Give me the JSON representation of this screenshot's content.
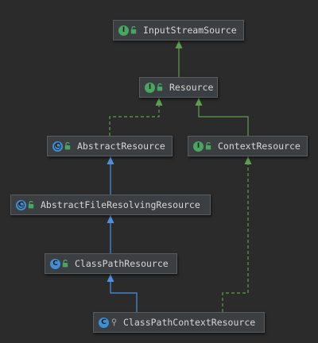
{
  "nodes": [
    {
      "id": "InputStreamSource",
      "label": "InputStreamSource",
      "kind": "interface",
      "badge": "I",
      "access": "public",
      "badge_color": "#4aa561"
    },
    {
      "id": "Resource",
      "label": "Resource",
      "kind": "interface",
      "badge": "I",
      "access": "public",
      "badge_color": "#4aa561"
    },
    {
      "id": "AbstractResource",
      "label": "AbstractResource",
      "kind": "abstract-class",
      "badge": "C",
      "access": "public",
      "badge_color": "#3f8fd6"
    },
    {
      "id": "ContextResource",
      "label": "ContextResource",
      "kind": "interface",
      "badge": "I",
      "access": "public",
      "badge_color": "#4aa561"
    },
    {
      "id": "AbstractFileResolvingResource",
      "label": "AbstractFileResolvingResource",
      "kind": "abstract-class",
      "badge": "C",
      "access": "public",
      "badge_color": "#3f8fd6"
    },
    {
      "id": "ClassPathResource",
      "label": "ClassPathResource",
      "kind": "class",
      "badge": "C",
      "access": "public",
      "badge_color": "#3f8fd6"
    },
    {
      "id": "ClassPathContextResource",
      "label": "ClassPathContextResource",
      "kind": "class",
      "badge": "C",
      "access": "package-private",
      "badge_color": "#3f8fd6"
    }
  ],
  "edges": [
    {
      "from": "Resource",
      "to": "InputStreamSource",
      "type": "extends-interface",
      "style": "solid",
      "color": "#5e9e4e"
    },
    {
      "from": "AbstractResource",
      "to": "Resource",
      "type": "implements",
      "style": "dashed",
      "color": "#5e9e4e"
    },
    {
      "from": "ContextResource",
      "to": "Resource",
      "type": "extends-interface",
      "style": "solid",
      "color": "#5e9e4e"
    },
    {
      "from": "AbstractFileResolvingResource",
      "to": "AbstractResource",
      "type": "extends",
      "style": "solid",
      "color": "#4f8fdc"
    },
    {
      "from": "ClassPathResource",
      "to": "AbstractFileResolvingResource",
      "type": "extends",
      "style": "solid",
      "color": "#4f8fdc"
    },
    {
      "from": "ClassPathContextResource",
      "to": "ClassPathResource",
      "type": "extends",
      "style": "solid",
      "color": "#4f8fdc"
    },
    {
      "from": "ClassPathContextResource",
      "to": "ContextResource",
      "type": "implements",
      "style": "dashed",
      "color": "#5e9e4e"
    }
  ]
}
